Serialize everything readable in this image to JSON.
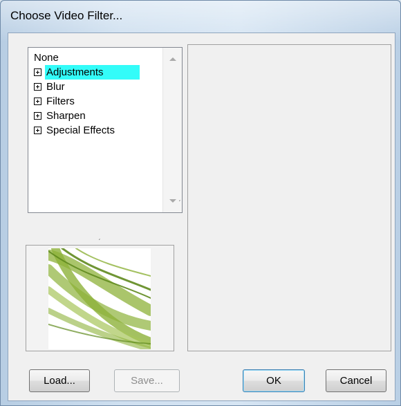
{
  "window": {
    "title": "Choose Video Filter..."
  },
  "tree": {
    "items": [
      {
        "label": "None",
        "expandable": false,
        "selected": false
      },
      {
        "label": "Adjustments",
        "expandable": true,
        "selected": true
      },
      {
        "label": "Blur",
        "expandable": true,
        "selected": false
      },
      {
        "label": "Filters",
        "expandable": true,
        "selected": false
      },
      {
        "label": "Sharpen",
        "expandable": true,
        "selected": false
      },
      {
        "label": "Special Effects",
        "expandable": true,
        "selected": false
      }
    ],
    "selection_color": "#33fcf9"
  },
  "preview": {
    "icon": "green-ribbon-thumbnail"
  },
  "buttons": {
    "load": "Load...",
    "save": "Save...",
    "ok": "OK",
    "cancel": "Cancel"
  },
  "colors": {
    "thumbnail_green": "#8db23a",
    "thumbnail_dark_green": "#5f8a1e"
  }
}
